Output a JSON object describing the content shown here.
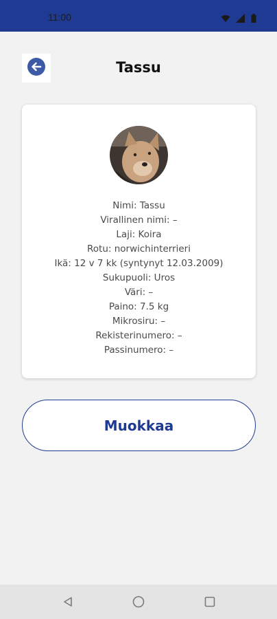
{
  "status_bar": {
    "time": "11:00",
    "icons": [
      "wifi-icon",
      "signal-icon",
      "battery-icon"
    ],
    "color": "#1f3a93"
  },
  "header": {
    "title": "Tassu",
    "back_icon": "arrow-left-icon"
  },
  "pet": {
    "avatar": "dog-photo",
    "details": [
      "Nimi: Tassu",
      "Virallinen nimi: –",
      "Laji: Koira",
      "Rotu: norwichinterrieri",
      "Ikä: 12 v 7 kk  (syntynyt 12.03.2009)",
      "Sukupuoli: Uros",
      "Väri: –",
      "Paino: 7.5 kg",
      "Mikrosiru: –",
      "Rekisterinumero: –",
      "Passinumero: –"
    ]
  },
  "actions": {
    "edit_label": "Muokkaa"
  },
  "nav_bar": {
    "buttons": [
      "back-triangle-icon",
      "home-circle-icon",
      "recents-square-icon"
    ]
  },
  "colors": {
    "brand": "#1f3a93",
    "background": "#f2f2f2",
    "card": "#ffffff"
  }
}
